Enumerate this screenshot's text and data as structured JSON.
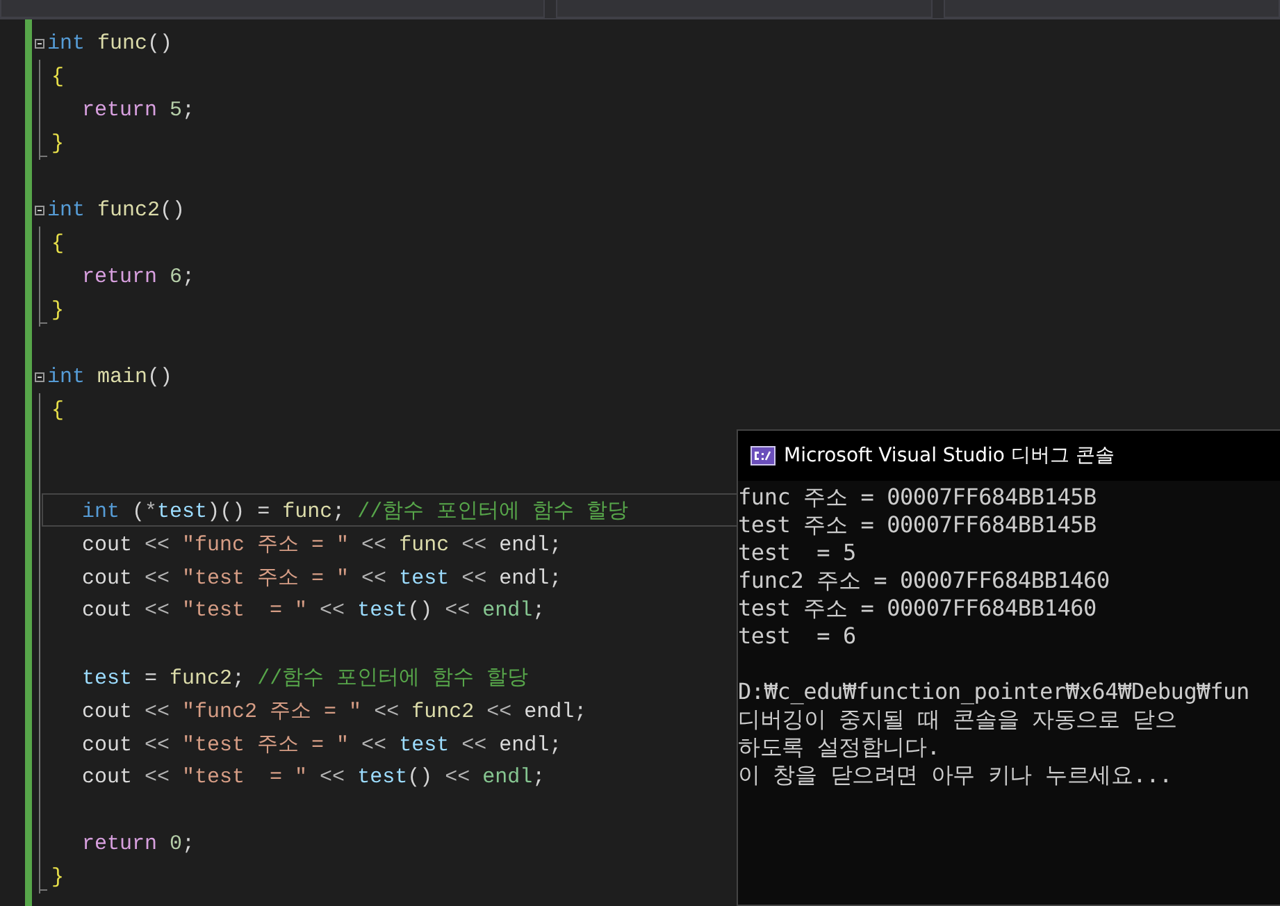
{
  "code": {
    "blocks": [
      {
        "lines": [
          {
            "kind": "header",
            "tokens": [
              {
                "text": "int",
                "kind": "keyword"
              },
              {
                "text": " func",
                "kind": "function"
              },
              {
                "text": "()",
                "kind": "punct"
              }
            ]
          },
          {
            "kind": "brace",
            "tokens": [
              {
                "text": "{",
                "kind": "brace"
              }
            ]
          },
          {
            "kind": "body",
            "tokens": [
              {
                "text": "return",
                "kind": "control"
              },
              {
                "text": " 5",
                "kind": "number"
              },
              {
                "text": ";",
                "kind": "punct"
              }
            ]
          },
          {
            "kind": "brace",
            "tokens": [
              {
                "text": "}",
                "kind": "brace"
              }
            ]
          }
        ]
      },
      {
        "lines": [
          {
            "kind": "header",
            "tokens": [
              {
                "text": "int",
                "kind": "keyword"
              },
              {
                "text": " func2",
                "kind": "function"
              },
              {
                "text": "()",
                "kind": "punct"
              }
            ]
          },
          {
            "kind": "brace",
            "tokens": [
              {
                "text": "{",
                "kind": "brace"
              }
            ]
          },
          {
            "kind": "body",
            "tokens": [
              {
                "text": "return",
                "kind": "control"
              },
              {
                "text": " 6",
                "kind": "number"
              },
              {
                "text": ";",
                "kind": "punct"
              }
            ]
          },
          {
            "kind": "brace",
            "tokens": [
              {
                "text": "}",
                "kind": "brace"
              }
            ]
          }
        ]
      },
      {
        "lines": [
          {
            "kind": "header",
            "tokens": [
              {
                "text": "int",
                "kind": "keyword"
              },
              {
                "text": " main",
                "kind": "function"
              },
              {
                "text": "()",
                "kind": "punct"
              }
            ]
          },
          {
            "kind": "brace",
            "tokens": [
              {
                "text": "{",
                "kind": "brace"
              }
            ]
          },
          {
            "kind": "blank"
          },
          {
            "kind": "blank"
          },
          {
            "kind": "current",
            "tokens": [
              {
                "text": "int",
                "kind": "keyword"
              },
              {
                "text": " (",
                "kind": "punct"
              },
              {
                "text": "*",
                "kind": "operator"
              },
              {
                "text": "test",
                "kind": "variable"
              },
              {
                "text": ")() = ",
                "kind": "punct"
              },
              {
                "text": "func",
                "kind": "function"
              },
              {
                "text": "; ",
                "kind": "punct"
              },
              {
                "text": "//함수 포인터에 함수 할당",
                "kind": "comment"
              }
            ]
          },
          {
            "kind": "body",
            "tokens": [
              {
                "text": "cout",
                "kind": "plain"
              },
              {
                "text": " << ",
                "kind": "operator"
              },
              {
                "text": "\"func 주소 = \"",
                "kind": "string"
              },
              {
                "text": " << ",
                "kind": "operator"
              },
              {
                "text": "func",
                "kind": "function"
              },
              {
                "text": " << ",
                "kind": "operator"
              },
              {
                "text": "endl",
                "kind": "plain"
              },
              {
                "text": ";",
                "kind": "punct"
              }
            ]
          },
          {
            "kind": "body",
            "tokens": [
              {
                "text": "cout",
                "kind": "plain"
              },
              {
                "text": " << ",
                "kind": "operator"
              },
              {
                "text": "\"test 주소 = \"",
                "kind": "string"
              },
              {
                "text": " << ",
                "kind": "operator"
              },
              {
                "text": "test",
                "kind": "variable"
              },
              {
                "text": " << ",
                "kind": "operator"
              },
              {
                "text": "endl",
                "kind": "plain"
              },
              {
                "text": ";",
                "kind": "punct"
              }
            ]
          },
          {
            "kind": "body",
            "tokens": [
              {
                "text": "cout",
                "kind": "plain"
              },
              {
                "text": " << ",
                "kind": "operator"
              },
              {
                "text": "\"test  = \"",
                "kind": "string"
              },
              {
                "text": " << ",
                "kind": "operator"
              },
              {
                "text": "test",
                "kind": "variable"
              },
              {
                "text": "()",
                "kind": "punct"
              },
              {
                "text": " << ",
                "kind": "operator"
              },
              {
                "text": "endl",
                "kind": "type"
              },
              {
                "text": ";",
                "kind": "punct"
              }
            ]
          },
          {
            "kind": "blank"
          },
          {
            "kind": "body",
            "tokens": [
              {
                "text": "test",
                "kind": "variable"
              },
              {
                "text": " = ",
                "kind": "punct"
              },
              {
                "text": "func2",
                "kind": "function"
              },
              {
                "text": "; ",
                "kind": "punct"
              },
              {
                "text": "//함수 포인터에 함수 할당",
                "kind": "comment"
              }
            ]
          },
          {
            "kind": "body",
            "tokens": [
              {
                "text": "cout",
                "kind": "plain"
              },
              {
                "text": " << ",
                "kind": "operator"
              },
              {
                "text": "\"func2 주소 = \"",
                "kind": "string"
              },
              {
                "text": " << ",
                "kind": "operator"
              },
              {
                "text": "func2",
                "kind": "function"
              },
              {
                "text": " << ",
                "kind": "operator"
              },
              {
                "text": "endl",
                "kind": "plain"
              },
              {
                "text": ";",
                "kind": "punct"
              }
            ]
          },
          {
            "kind": "body",
            "tokens": [
              {
                "text": "cout",
                "kind": "plain"
              },
              {
                "text": " << ",
                "kind": "operator"
              },
              {
                "text": "\"test 주소 = \"",
                "kind": "string"
              },
              {
                "text": " << ",
                "kind": "operator"
              },
              {
                "text": "test",
                "kind": "variable"
              },
              {
                "text": " << ",
                "kind": "operator"
              },
              {
                "text": "endl",
                "kind": "plain"
              },
              {
                "text": ";",
                "kind": "punct"
              }
            ]
          },
          {
            "kind": "body",
            "tokens": [
              {
                "text": "cout",
                "kind": "plain"
              },
              {
                "text": " << ",
                "kind": "operator"
              },
              {
                "text": "\"test  = \"",
                "kind": "string"
              },
              {
                "text": " << ",
                "kind": "operator"
              },
              {
                "text": "test",
                "kind": "variable"
              },
              {
                "text": "()",
                "kind": "punct"
              },
              {
                "text": " << ",
                "kind": "operator"
              },
              {
                "text": "endl",
                "kind": "type"
              },
              {
                "text": ";",
                "kind": "punct"
              }
            ]
          },
          {
            "kind": "blank"
          },
          {
            "kind": "body",
            "tokens": [
              {
                "text": "return",
                "kind": "control"
              },
              {
                "text": " 0",
                "kind": "number"
              },
              {
                "text": ";",
                "kind": "punct"
              }
            ]
          },
          {
            "kind": "brace",
            "tokens": [
              {
                "text": "}",
                "kind": "brace"
              }
            ]
          }
        ]
      }
    ]
  },
  "console": {
    "title": "Microsoft Visual Studio 디버그 콘솔",
    "output": [
      "func 주소 = 00007FF684BB145B",
      "test 주소 = 00007FF684BB145B",
      "test  = 5",
      "func2 주소 = 00007FF684BB1460",
      "test 주소 = 00007FF684BB1460",
      "test  = 6"
    ],
    "messages": [
      "D:₩c_edu₩function_pointer₩x64₩Debug₩fun",
      "디버깅이 중지될 때 콘솔을 자동으로 닫으",
      "하도록 설정합니다.",
      "이 창을 닫으려면 아무 키나 누르세요..."
    ]
  }
}
